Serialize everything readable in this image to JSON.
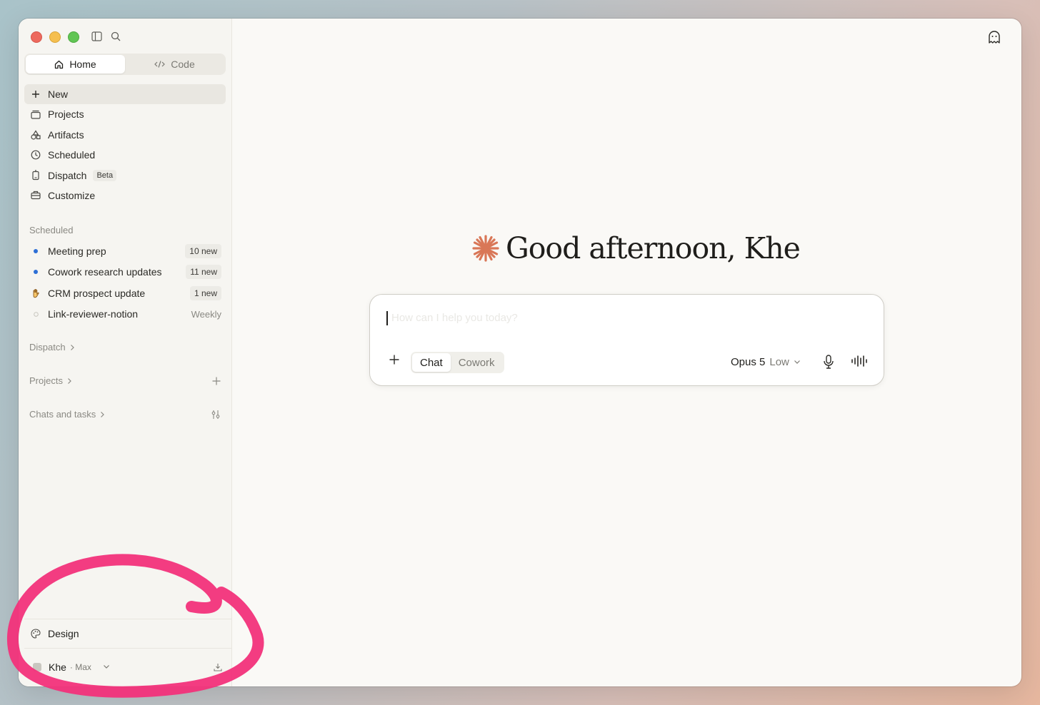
{
  "colors": {
    "accent": "#d97757",
    "active_dot": "#2d6fd6",
    "annotation": "#f2327a"
  },
  "nav": {
    "home_label": "Home",
    "code_label": "Code",
    "items": [
      {
        "label": "New",
        "icon": "plus-icon"
      },
      {
        "label": "Projects",
        "icon": "folder-icon"
      },
      {
        "label": "Artifacts",
        "icon": "shapes-icon"
      },
      {
        "label": "Scheduled",
        "icon": "clock-icon"
      },
      {
        "label": "Dispatch",
        "icon": "phone-icon",
        "badge": "Beta"
      },
      {
        "label": "Customize",
        "icon": "briefcase-icon"
      }
    ]
  },
  "scheduled": {
    "title": "Scheduled",
    "items": [
      {
        "name": "Meeting prep",
        "count": "10 new",
        "icon": "blue-dot"
      },
      {
        "name": "Cowork research updates",
        "count": "11 new",
        "icon": "blue-dot"
      },
      {
        "name": "CRM prospect update",
        "count": "1 new",
        "icon": "hand-icon"
      },
      {
        "name": "Link-reviewer-notion",
        "frequency": "Weekly",
        "icon": "empty-dot"
      }
    ]
  },
  "sections": {
    "dispatch": "Dispatch",
    "projects": "Projects",
    "chats": "Chats and tasks"
  },
  "bottom": {
    "design_label": "Design",
    "user_name": "Khe",
    "user_plan": "· Max"
  },
  "main": {
    "greeting": "Good afternoon, Khe",
    "composer": {
      "placeholder": "How can I help you today?",
      "modes": [
        "Chat",
        "Cowork"
      ],
      "active_mode": "Chat",
      "model": "Opus 5",
      "effort": "Low"
    }
  }
}
